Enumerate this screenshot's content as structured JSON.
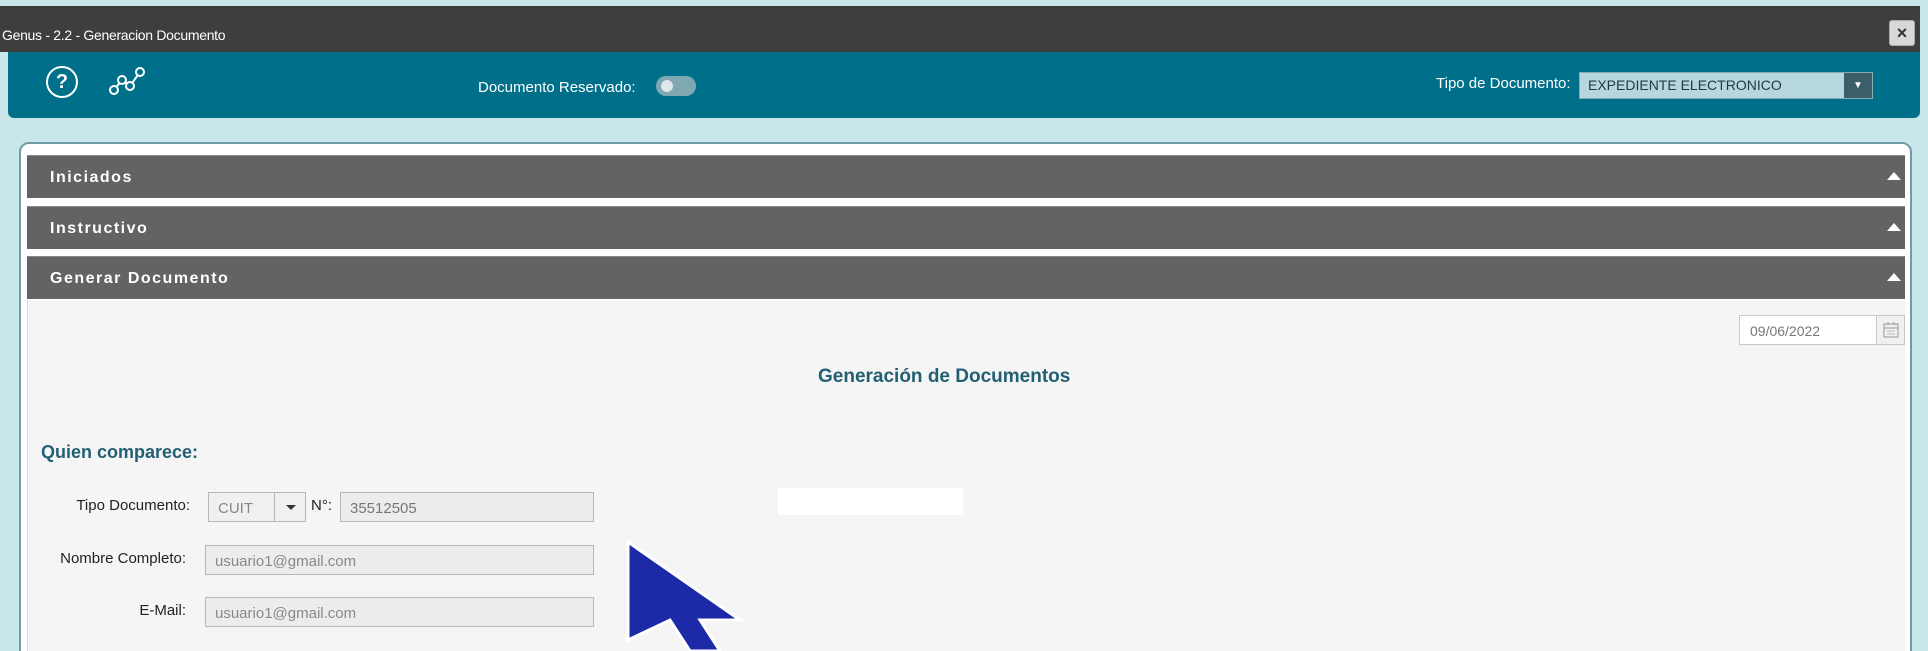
{
  "window": {
    "title": "Genus - 2.2 - Generacion Documento",
    "close_glyph": "×"
  },
  "toolbar": {
    "help_glyph": "?",
    "reserved_label": "Documento Reservado:",
    "tipo_label": "Tipo de Documento:",
    "tipo_value": "EXPEDIENTE ELECTRONICO"
  },
  "panels": [
    {
      "title": "Iniciados"
    },
    {
      "title": "Instructivo"
    },
    {
      "title": "Generar Documento"
    }
  ],
  "form": {
    "date": "09/06/2022",
    "heading": "Generación de Documentos",
    "subheading": "Quien comparece:",
    "tipo_documento_label": "Tipo Documento:",
    "tipo_documento_value": "CUIT",
    "numero_label": "N°:",
    "numero_value": "35512505",
    "nombre_label": "Nombre Completo:",
    "nombre_value": "usuario1@gmail.com",
    "email_label": "E-Mail:",
    "email_value": "usuario1@gmail.com"
  },
  "colors": {
    "toolbar": "#00708a",
    "panel_header": "#636363",
    "accent_text": "#235f73"
  },
  "icons": [
    "help-icon",
    "graph-icon",
    "close-icon",
    "calendar-icon",
    "dropdown-arrow-icon",
    "collapse-caret-icon",
    "mouse-cursor-icon"
  ]
}
